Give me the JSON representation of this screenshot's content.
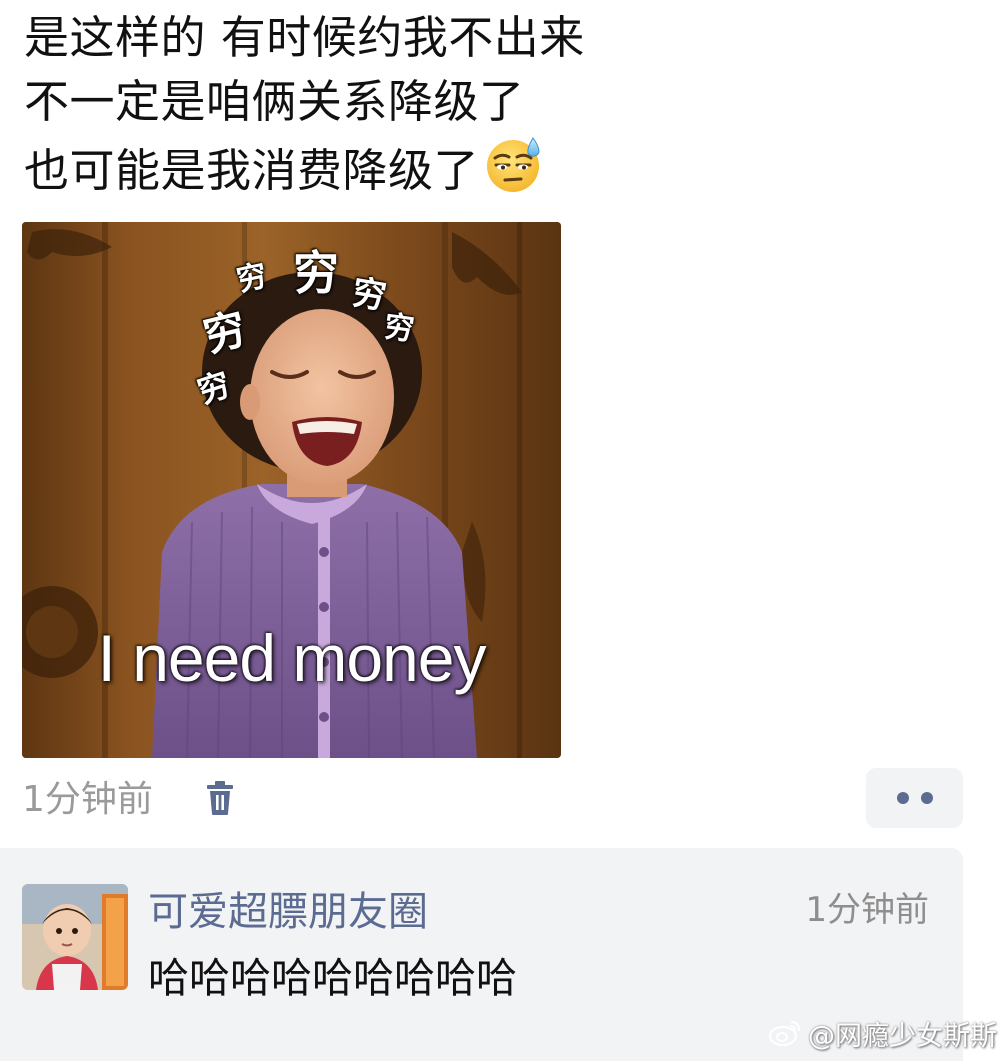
{
  "post": {
    "lines": [
      "是这样的 有时候约我不出来",
      "不一定是咱俩关系降级了",
      "也可能是我消费降级了"
    ],
    "trailing_emoji": "sweat-smile-emoji"
  },
  "meme": {
    "caption": "I need money",
    "overlay_char": "穷"
  },
  "meta": {
    "timestamp": "1分钟前",
    "delete_icon": "trash-icon",
    "more_icon": "more-dots-icon"
  },
  "comment": {
    "author": "可爱超膘朋友圈",
    "time": "1分钟前",
    "text": "哈哈哈哈哈哈哈哈哈"
  },
  "watermark": {
    "text": "@网瘾少女斯斯",
    "icon": "weibo-logo-icon"
  },
  "colors": {
    "link_blue": "#5b6b91",
    "panel_bg": "#f2f3f5",
    "muted_text": "#9a9a9a"
  }
}
